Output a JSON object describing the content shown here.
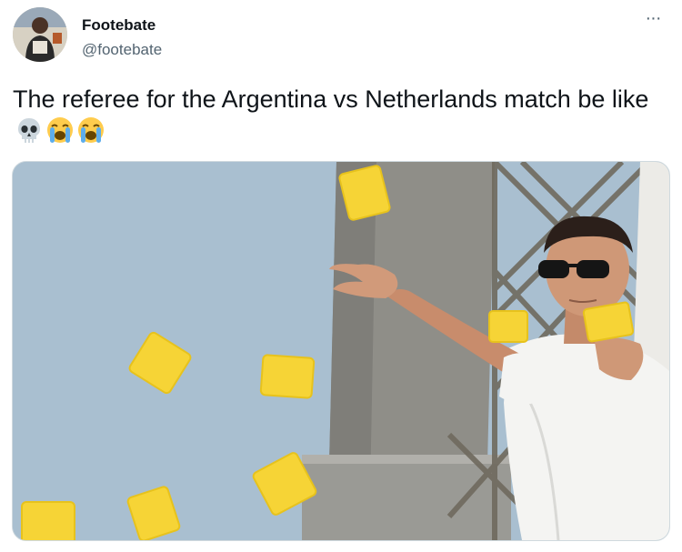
{
  "tweet": {
    "author_name": "Footebate",
    "author_handle": "@footebate",
    "more_label": "···",
    "text": "The referee for the Argentina vs Netherlands match be like",
    "emojis": [
      "skull-emoji",
      "loudly-crying-face-emoji",
      "loudly-crying-face-emoji"
    ]
  },
  "colors": {
    "text_primary": "#0f1419",
    "text_secondary": "#536471",
    "card_yellow": "#f6d436",
    "sky": "#a9bfd0"
  }
}
